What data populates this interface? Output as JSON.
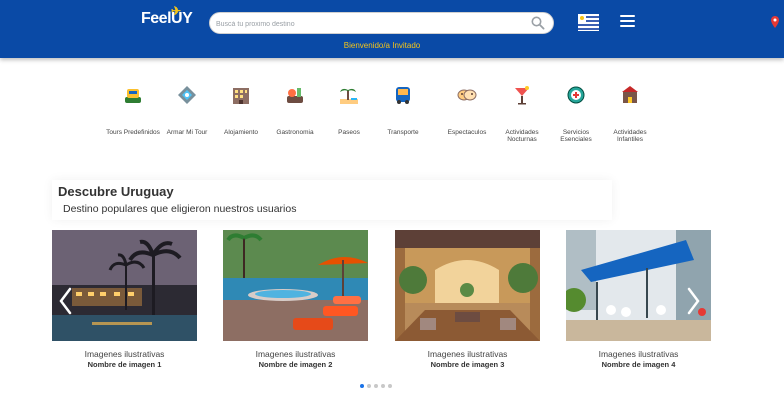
{
  "header": {
    "logo_text": "FeelUY",
    "search": {
      "placeholder": "Buscá tu proximo destino"
    },
    "welcome": "Bienvenido/a Invitado",
    "icons": [
      "search-icon",
      "uruguay-flag-icon",
      "hamburger-menu-icon",
      "location-pin-icon",
      "plane-icon"
    ]
  },
  "categories": [
    {
      "label": "Tours Predefinidos",
      "icon": "tour-icon"
    },
    {
      "label": "Armar Mi Tour",
      "icon": "build-tour-icon"
    },
    {
      "label": "Alojamiento",
      "icon": "hotel-icon"
    },
    {
      "label": "Gastronomia",
      "icon": "food-icon"
    },
    {
      "label": "Paseos",
      "icon": "beach-icon"
    },
    {
      "label": "Transporte",
      "icon": "bus-icon"
    },
    {
      "label": "Espectaculos",
      "icon": "mask-icon"
    },
    {
      "label": "Actividades Nocturnas",
      "icon": "cocktail-icon"
    },
    {
      "label": "Servicios Esenciales",
      "icon": "services-icon"
    },
    {
      "label": "Actividades Infantiles",
      "icon": "kids-icon"
    }
  ],
  "discover": {
    "title": "Descubre Uruguay",
    "subtitle": "Destino populares que eligieron nuestros usuarios"
  },
  "carousel": {
    "cards": [
      {
        "caption": "Imagenes ilustrativas",
        "name": "Nombre de imagen 1",
        "scene": "night-resort"
      },
      {
        "caption": "Imagenes ilustrativas",
        "name": "Nombre de imagen 2",
        "scene": "pool-deck"
      },
      {
        "caption": "Imagenes ilustrativas",
        "name": "Nombre de imagen 3",
        "scene": "courtyard"
      },
      {
        "caption": "Imagenes ilustrativas",
        "name": "Nombre de imagen 4",
        "scene": "terrace"
      }
    ],
    "dots": 5,
    "active_dot": 0
  },
  "colors": {
    "header_bg": "#0a4aa6",
    "welcome_text": "#f5c518",
    "active_dot": "#1a73e8"
  }
}
